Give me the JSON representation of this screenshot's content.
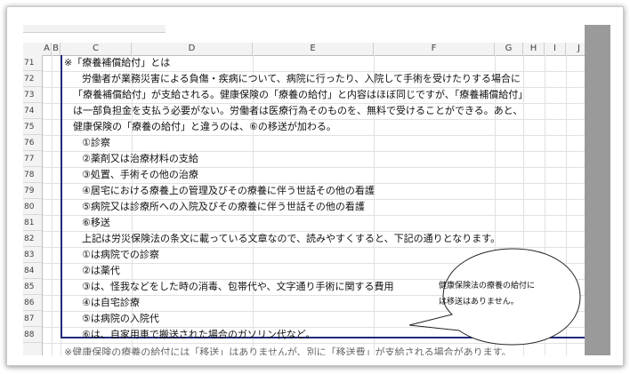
{
  "columns": [
    "A",
    "B",
    "C",
    "D",
    "E",
    "F",
    "G",
    "H",
    "I",
    "J"
  ],
  "rows": [
    "71",
    "72",
    "73",
    "74",
    "75",
    "76",
    "77",
    "78",
    "79",
    "80",
    "81",
    "82",
    "83",
    "84",
    "85",
    "86",
    "87",
    "88"
  ],
  "lines": [
    "※「療養補償給付」とは",
    "労働者が業務災害による負傷・疾病について、病院に行ったり、入院して手術を受けたりする場合に",
    "「療養補償給付」が支給される。健康保険の「療養の給付」と内容はほぼ同じですが、「療養補償給付」",
    "は一部負担金を支払う必要がない。労働者は医療行為そのものを、無料で受けることができる。あと、",
    "健康保険の「療養の給付」と違うのは、⑥の移送が加わる。",
    "①診察",
    "②薬剤又は治療材料の支給",
    "③処置、手術その他の治療",
    "④居宅における療養上の管理及びその療養に伴う世話その他の看護",
    "⑤病院又は診療所への入院及びその療養に伴う世話その他の看護",
    "⑥移送",
    "上記は労災保険法の条文に載っている文章なので、読みやすくすると、下記の通りとなります。",
    "①は病院での診察",
    "②は薬代",
    "③は、怪我などをした時の消毒、包帯代や、文字通り手術に関する費用",
    "④は自宅診療",
    "⑤は病院の入院代",
    "⑥は、自家用車で搬送された場合のガソリン代など。",
    "※健康保険の療養の給付には「移送」はありませんが、別に「移送費」が支給される場合があります。"
  ],
  "callout": {
    "line1": "健康保険法の療養の給付に",
    "line2": "は移送はありません。"
  }
}
